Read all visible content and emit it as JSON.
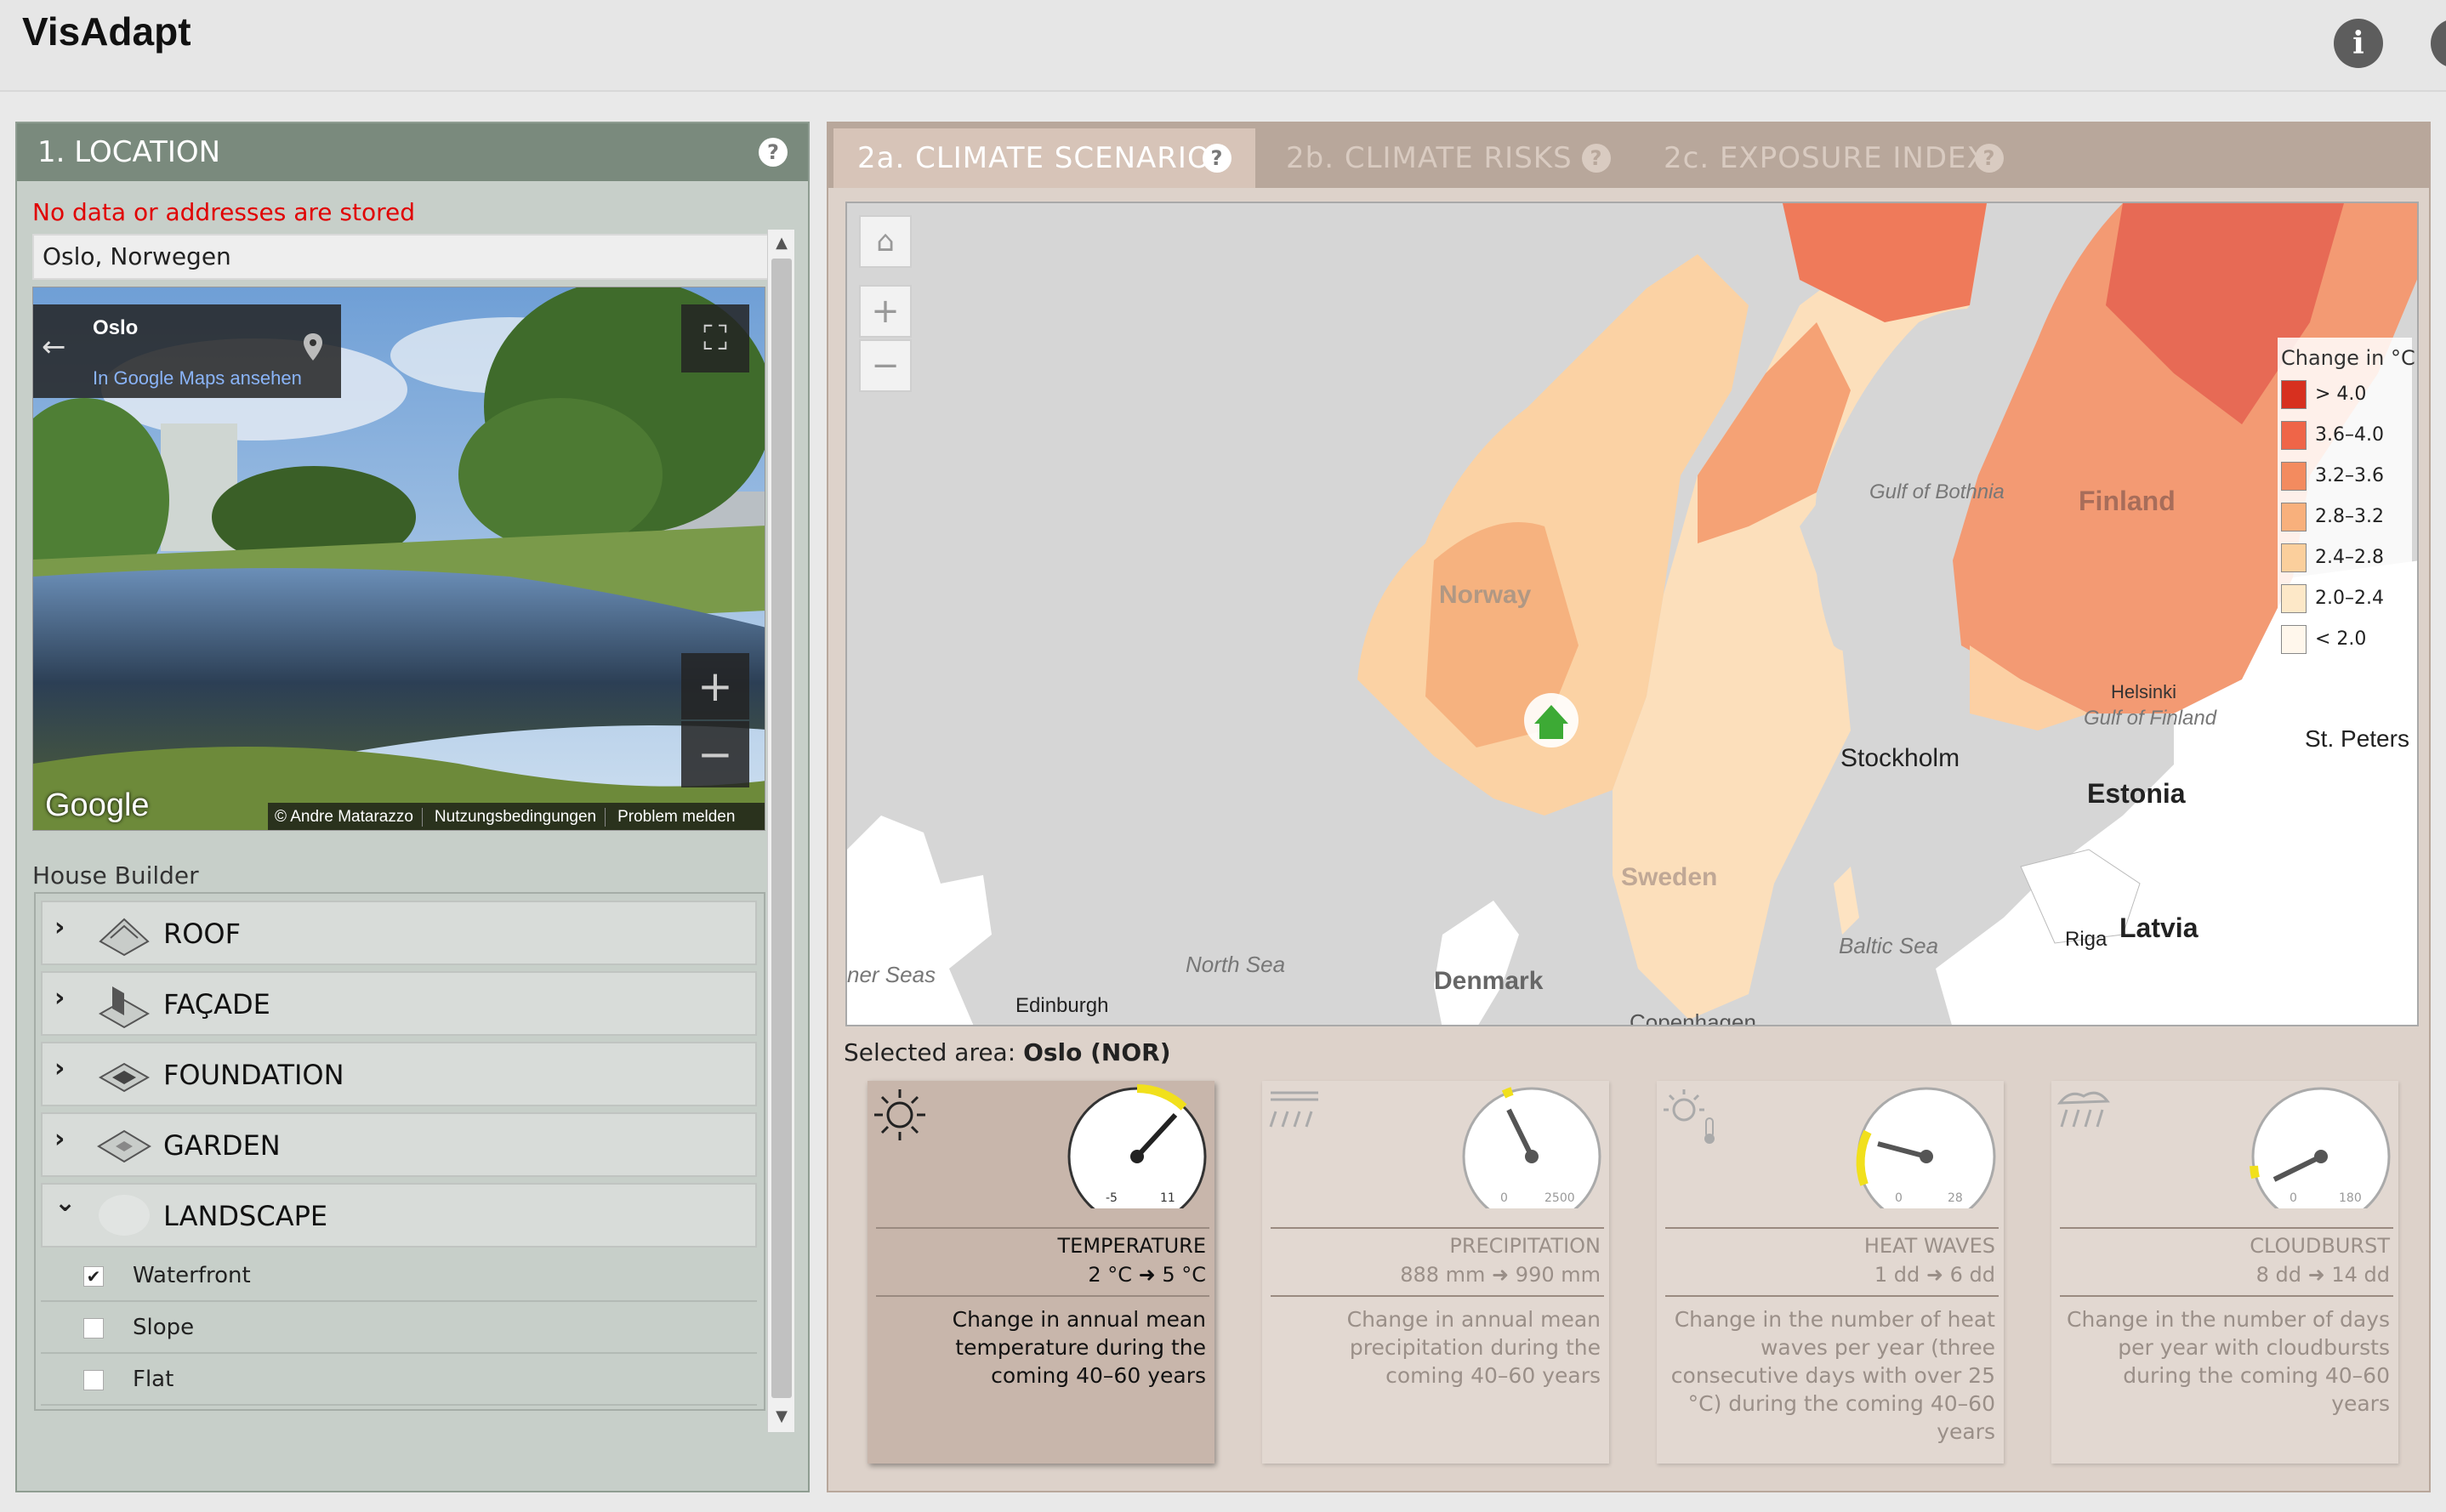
{
  "app": {
    "title": "VisAdapt"
  },
  "header_icons": [
    "info-icon",
    "info-icon-2"
  ],
  "location": {
    "header": "1. LOCATION",
    "help": "?",
    "warning": "No data or addresses are stored",
    "address": "Oslo, Norwegen",
    "streetview": {
      "place": "Oslo",
      "maps_link": "In Google Maps ansehen",
      "google_logo": "Google",
      "footer": [
        "© Andre Matarazzo",
        "Nutzungsbedingungen",
        "Problem melden"
      ]
    }
  },
  "house_builder": {
    "label": "House Builder",
    "items": [
      {
        "label": "ROOF",
        "expanded": false
      },
      {
        "label": "FAÇADE",
        "expanded": false
      },
      {
        "label": "FOUNDATION",
        "expanded": false
      },
      {
        "label": "GARDEN",
        "expanded": false
      },
      {
        "label": "LANDSCAPE",
        "expanded": true
      }
    ],
    "landscape_options": [
      {
        "label": "Waterfront",
        "checked": true
      },
      {
        "label": "Slope",
        "checked": false
      },
      {
        "label": "Flat",
        "checked": false
      }
    ]
  },
  "tabs": [
    {
      "label": "2a. CLIMATE SCENARIOS",
      "active": true
    },
    {
      "label": "2b. CLIMATE RISKS",
      "active": false
    },
    {
      "label": "2c. EXPOSURE INDEX",
      "active": false
    }
  ],
  "map": {
    "controls": {
      "zoom_in": "+",
      "zoom_out": "−"
    },
    "labels": {
      "norway": "Norway",
      "sweden": "Sweden",
      "finland": "Finland",
      "estonia": "Estonia",
      "latvia": "Latvia",
      "denmark": "Denmark",
      "stockholm": "Stockholm",
      "riga": "Riga",
      "edinburgh": "Edinburgh",
      "helsinki": "Helsinki",
      "st_petersburg": "St. Peters",
      "gulf_bothnia": "Gulf of Bothnia",
      "gulf_finland": "Gulf of Finland",
      "north_sea": "North Sea",
      "baltic_sea": "Baltic Sea",
      "norw_sea": "ner Seas",
      "copenhagen": "Copenhagen"
    },
    "legend": {
      "title": "Change in °C",
      "items": [
        {
          "label": "> 4.0",
          "color": "#d7301f"
        },
        {
          "label": "3.6–4.0",
          "color": "#ef6548"
        },
        {
          "label": "3.2–3.6",
          "color": "#f38b5f"
        },
        {
          "label": "2.8–3.2",
          "color": "#f8b07c"
        },
        {
          "label": "2.4–2.8",
          "color": "#fbcf9c"
        },
        {
          "label": "2.0–2.4",
          "color": "#fde8c8"
        },
        {
          "label": "< 2.0",
          "color": "#fff7ec"
        }
      ]
    }
  },
  "selected": {
    "prefix": "Selected area:",
    "value": "Oslo (NOR)"
  },
  "cards": [
    {
      "icon": "sun-icon",
      "name": "TEMPERATURE",
      "range": "2 °C ➜ 5 °C",
      "desc": "Change in annual mean temperature during the coming 40–60 years",
      "gauge_min": "-5",
      "gauge_max": "11",
      "active": true
    },
    {
      "icon": "rain-icon",
      "name": "PRECIPITATION",
      "range": "888 mm ➜ 990 mm",
      "desc": "Change in annual mean precipitation during the coming 40–60 years",
      "gauge_min": "0",
      "gauge_max": "2500",
      "active": false
    },
    {
      "icon": "heat-icon",
      "name": "HEAT WAVES",
      "range": "1 dd ➜ 6 dd",
      "desc": "Change in the number of heat waves per year (three consecutive days with over 25 °C) during the coming 40–60 years",
      "gauge_min": "0",
      "gauge_max": "28",
      "active": false
    },
    {
      "icon": "cloudburst-icon",
      "name": "CLOUDBURST",
      "range": "8 dd ➜ 14 dd",
      "desc": "Change in the number of days per year with cloudbursts during the coming 40–60 years",
      "gauge_min": "0",
      "gauge_max": "180",
      "active": false
    }
  ]
}
